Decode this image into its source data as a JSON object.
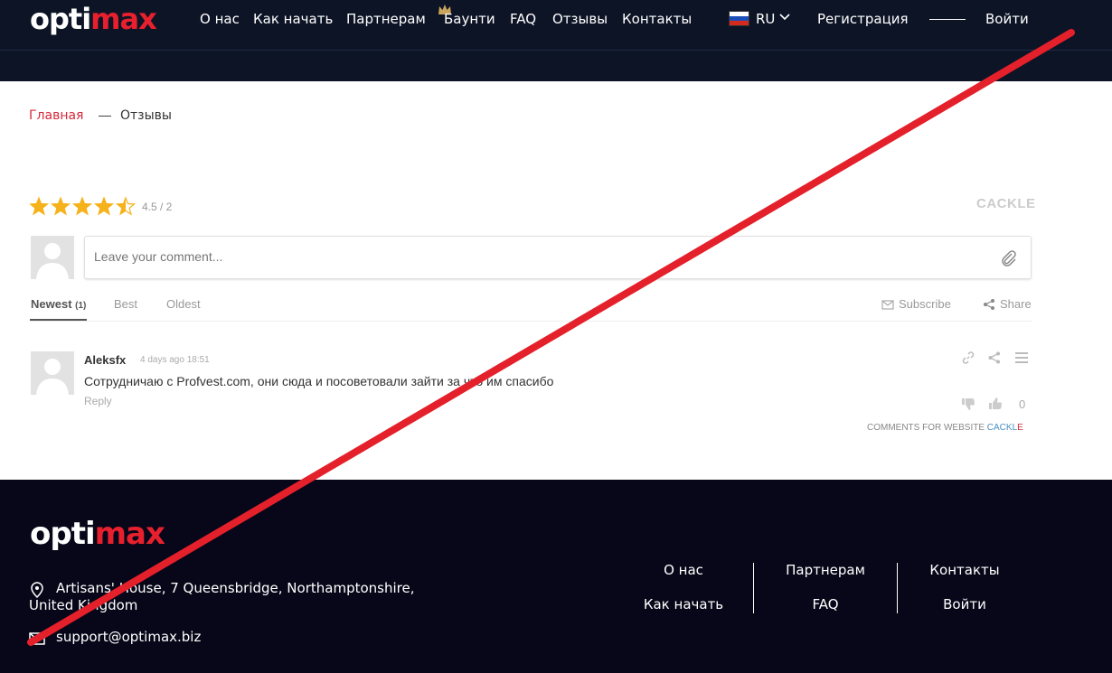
{
  "header": {
    "logo": {
      "part1": "opti",
      "part2": "max"
    },
    "nav": [
      {
        "label": "О нас"
      },
      {
        "label": "Как начать"
      },
      {
        "label": "Партнерам"
      },
      {
        "label": "Баунти"
      },
      {
        "label": "FAQ"
      },
      {
        "label": "Отзывы"
      },
      {
        "label": "Контакты"
      }
    ],
    "language": "RU",
    "register_label": "Регистрация",
    "login_label": "Войти"
  },
  "breadcrumb": {
    "home": "Главная",
    "separator": "—",
    "current": "Отзывы"
  },
  "widget": {
    "rating": 4.5,
    "rating_label": "4.5 / 2",
    "brand": "CACKLE",
    "comment_placeholder": "Leave your comment...",
    "tabs": [
      {
        "label": "Newest",
        "count": "(1)"
      },
      {
        "label": "Best"
      },
      {
        "label": "Oldest"
      }
    ],
    "subscribe_label": "Subscribe",
    "share_label": "Share",
    "comments": [
      {
        "author": "Aleksfx",
        "time": "4 days ago 18:51",
        "text": "Сотрудничаю с Profvest.com, они сюда и посоветовали зайти за что им спасибо",
        "reply_label": "Reply",
        "score": "0"
      }
    ],
    "powered_prefix": "COMMENTS FOR WEBSITE ",
    "powered_brand_main": "CACKL",
    "powered_brand_end": "E"
  },
  "footer": {
    "logo": {
      "part1": "opti",
      "part2": "max"
    },
    "address": "Artisans' House, 7 Queensbridge, Northamptonshire, United Kingdom",
    "email": "support@optimax.biz",
    "links": [
      {
        "label": "О нас"
      },
      {
        "label": "Как начать"
      },
      {
        "label": "Партнерам"
      },
      {
        "label": "FAQ"
      },
      {
        "label": "Контакты"
      },
      {
        "label": "Войти"
      }
    ]
  },
  "colors": {
    "header_bg": "#0d1426",
    "footer_bg": "#070719",
    "brand_red": "#e8202e",
    "breadcrumb_link": "#d6283b",
    "star": "#f6b21b",
    "overlay_slash": "#e4202b"
  }
}
